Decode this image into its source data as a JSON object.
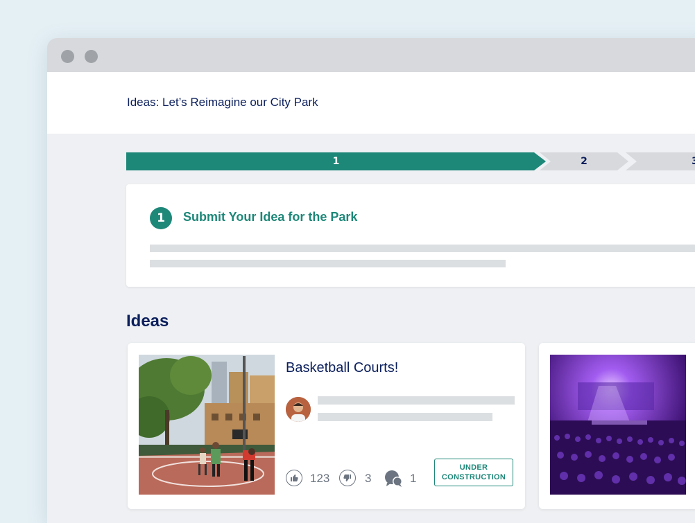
{
  "header": {
    "title": "Ideas: Let’s Reimagine our City Park"
  },
  "stepper": {
    "steps": [
      "1",
      "2",
      "3"
    ],
    "active_step": 1
  },
  "phase": {
    "number": "1",
    "title": "Submit Your Idea for the Park"
  },
  "ideas_section": {
    "heading": "Ideas"
  },
  "ideas": [
    {
      "title": "Basketball Courts!",
      "likes": "123",
      "dislikes": "3",
      "comments": "1",
      "status_line1": "UNDER",
      "status_line2": "CONSTRUCTION"
    }
  ],
  "icons": {
    "like": "thumbs-up-icon",
    "dislike": "thumbs-down-icon",
    "comments": "comments-icon"
  },
  "colors": {
    "accent": "#1d8778",
    "text": "#0b1f5c",
    "placeholder": "#dcdfe2",
    "muted": "#6b7480"
  }
}
